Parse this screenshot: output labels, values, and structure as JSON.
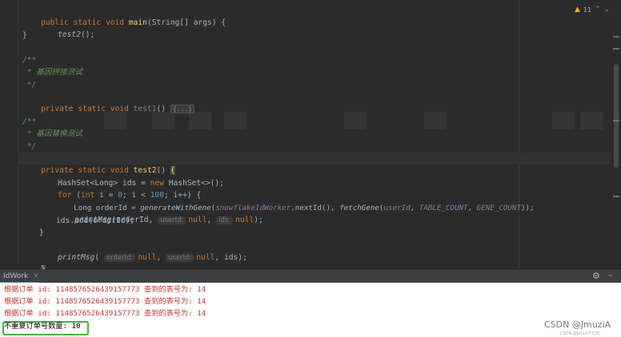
{
  "editor": {
    "inspection_count": "11",
    "lines": {
      "l1": {
        "kw": "public static void ",
        "fn": "main",
        "rest": "(String[] args) {"
      },
      "l2": {
        "call": "test2",
        "rest": "();"
      },
      "l3": "}",
      "l4": "/**",
      "l5": " * 基因拼接测试",
      "l6": " */",
      "l7": {
        "kw": "private static void ",
        "name": "test1",
        "rest": "() ",
        "fold": "{...}"
      },
      "l8": "/**",
      "l9": " * 基因替换测试",
      "l10": " */",
      "l11": {
        "kw": "private static void ",
        "fn": "test2",
        "rest": "() ",
        "brace": "{"
      },
      "l12": {
        "a": "HashSet<Long> ids = ",
        "new": "new ",
        "b": "HashSet<>();"
      },
      "l13": {
        "for": "for ",
        "a": "(",
        "int": "int ",
        "b": "i = ",
        "n0": "0",
        "c": "; i < ",
        "n100": "100",
        "d": "; i++) {"
      },
      "l14": {
        "a": "Long orderId = ",
        "gen": "generateWithGene",
        "b": "(",
        "worker": "snowflakeIdWorker",
        "c": ".nextId(), ",
        "fetch": "fetchGene",
        "d": "(",
        "uid": "userId",
        "e": ", ",
        "tc": "TABLE_COUNT",
        "f": ", ",
        "gc": "GENE_COUNT",
        "g": "));"
      },
      "l15": {
        "pm": "printMsg",
        "a": "(orderId, ",
        "hint1": "userId:",
        "null1": "null",
        "b": ", ",
        "hint2": "ids:",
        "null2": "null",
        "c": ");"
      },
      "l16": "ids.add(orderId);",
      "l17": "}",
      "l18": {
        "pm": "printMsg",
        "a": "( ",
        "hint1": "orderId:",
        "null1": "null",
        "b": ", ",
        "hint2": "userId:",
        "null2": "null",
        "c": ", ids);"
      },
      "l19": "}"
    }
  },
  "run_panel": {
    "tab_label": "IdWork",
    "close_glyph": "×",
    "gear_glyph": "⚙",
    "minimize_glyph": "–"
  },
  "console": {
    "lines": [
      "根据订单 id: 1148576526439157773 查到的表号为: 14",
      "根据订单 id: 1148576526439157773 查到的表号为: 14",
      "根据订单 id: 1148576526439157773 查到的表号为: 14"
    ],
    "summary": "不重复订单号数量: 10"
  },
  "watermark": {
    "main": "CSDN @JmuziA",
    "sub": "CSDN @Jmuzi不打鸣"
  },
  "colors": {
    "editor_bg": "#2b2b2b",
    "keyword": "#cc7832",
    "function": "#ffc66d",
    "number": "#6897bb",
    "comment": "#629755",
    "console_text": "#cc3333",
    "highlight_box": "#3fb53f"
  }
}
